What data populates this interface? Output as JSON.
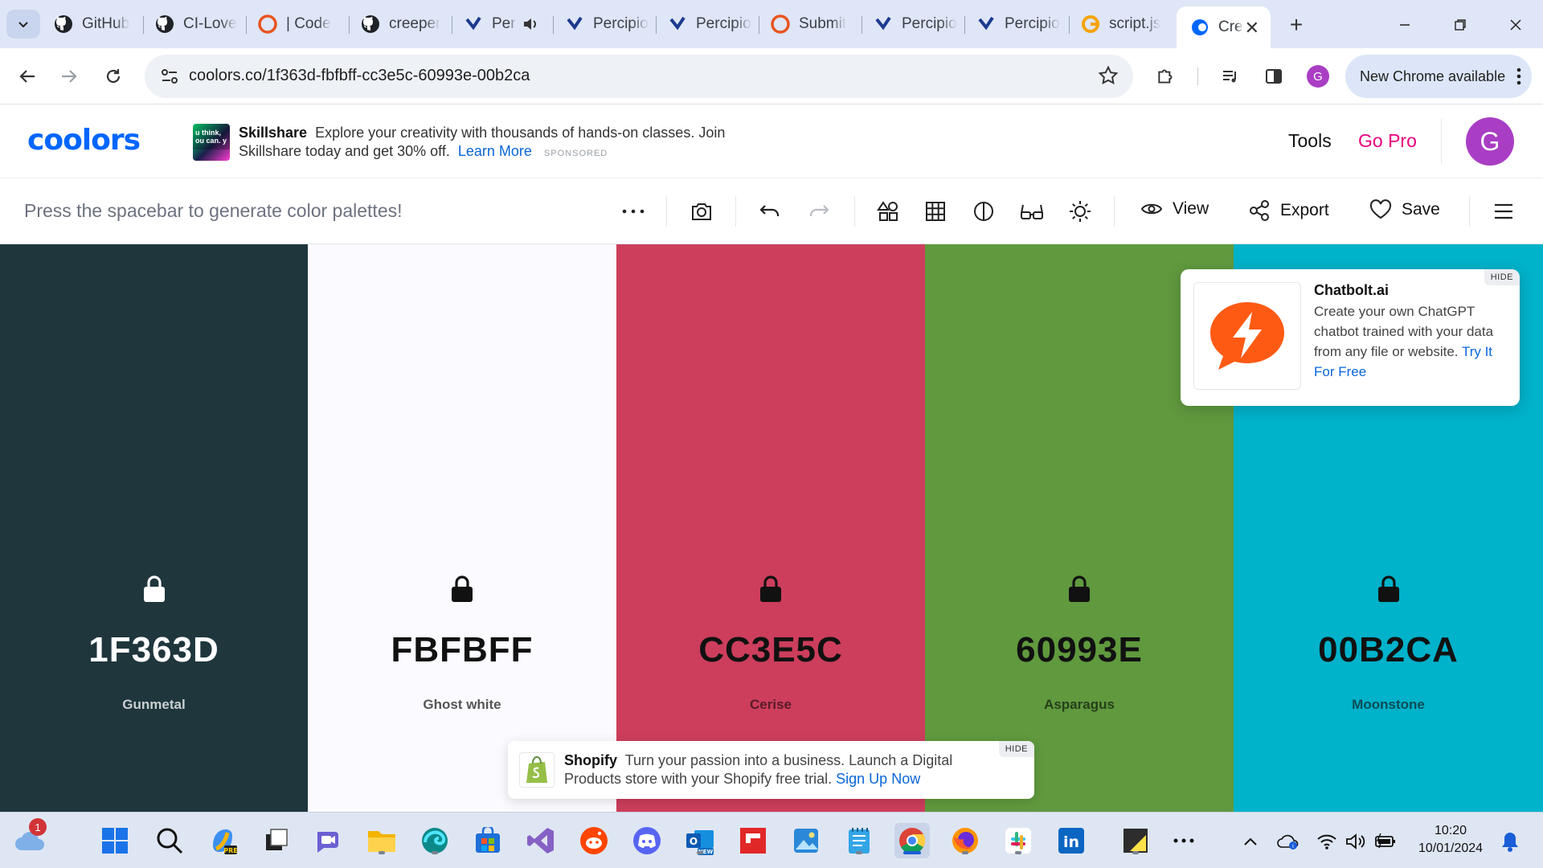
{
  "browser": {
    "tabs": [
      {
        "label": "GitHub",
        "icon": "github-icon"
      },
      {
        "label": "CI-Love",
        "icon": "github-icon"
      },
      {
        "label": "| Code",
        "icon": "codepen-icon"
      },
      {
        "label": "creeper",
        "icon": "github-icon"
      },
      {
        "label": "Per",
        "icon": "percipio-icon"
      },
      {
        "label": "Percipio",
        "icon": "percipio-icon"
      },
      {
        "label": "Percipio",
        "icon": "percipio-icon"
      },
      {
        "label": "Submit",
        "icon": "codepen-icon"
      },
      {
        "label": "Percipio",
        "icon": "percipio-icon"
      },
      {
        "label": "Percipio",
        "icon": "percipio-icon"
      },
      {
        "label": "script.js",
        "icon": "google-icon"
      },
      {
        "label": "Cre",
        "icon": "coolors-icon",
        "active": true
      }
    ],
    "url": "coolors.co/1f363d-fbfbff-cc3e5c-60993e-00b2ca",
    "new_chrome_label": "New Chrome available",
    "profile_initial": "G"
  },
  "site": {
    "logo": "coolors",
    "ad": {
      "brand": "Skillshare",
      "text": "Explore your creativity with thousands of hands-on classes. Join Skillshare today and get 30% off.",
      "link": "Learn More",
      "sponsored": "SPONSORED",
      "thumb_text": "u think, ou can. y"
    },
    "nav_tools": "Tools",
    "nav_gopro": "Go Pro",
    "avatar_initial": "G"
  },
  "toolbar": {
    "hint": "Press the spacebar to generate color palettes!",
    "view_label": "View",
    "export_label": "Export",
    "save_label": "Save"
  },
  "palette": [
    {
      "hex": "1F363D",
      "name": "Gunmetal",
      "bg": "#1F363D",
      "fg": "#FFFFFF",
      "name_color": "#C9D0D2"
    },
    {
      "hex": "FBFBFF",
      "name": "Ghost white",
      "bg": "#FBFBFF",
      "fg": "#111111",
      "name_color": "#555555"
    },
    {
      "hex": "CC3E5C",
      "name": "Cerise",
      "bg": "#CC3E5C",
      "fg": "#111111",
      "name_color": "#5a1a28"
    },
    {
      "hex": "60993E",
      "name": "Asparagus",
      "bg": "#60993E",
      "fg": "#111111",
      "name_color": "#26401a"
    },
    {
      "hex": "00B2CA",
      "name": "Moonstone",
      "bg": "#00B2CA",
      "fg": "#111111",
      "name_color": "#0a4d57"
    }
  ],
  "chatbolt_ad": {
    "title": "Chatbolt.ai",
    "body": "Create your own ChatGPT chatbot trained with your data from any file or website.",
    "link": "Try It For Free",
    "hide": "HIDE"
  },
  "shopify_ad": {
    "brand": "Shopify",
    "body": "Turn your passion into a business. Launch a Digital Products store with your Shopify free trial.",
    "link": "Sign Up Now",
    "hide": "HIDE"
  },
  "taskbar": {
    "weather_badge": "1",
    "time": "10:20",
    "date": "10/01/2024"
  }
}
